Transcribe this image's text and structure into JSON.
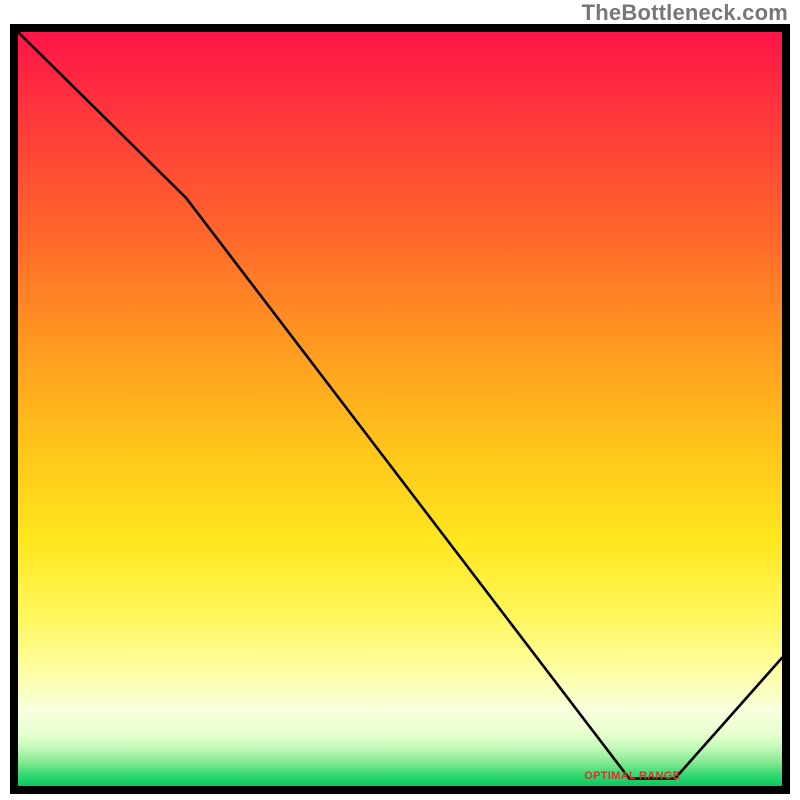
{
  "watermark": "TheBottleneck.com",
  "annotation": {
    "optimal_label": "OPTIMAL RANGE"
  },
  "chart_data": {
    "type": "line",
    "title": "",
    "xlabel": "",
    "ylabel": "",
    "xlim": [
      0,
      100
    ],
    "ylim": [
      0,
      100
    ],
    "grid": false,
    "legend": false,
    "x": [
      0,
      22,
      80,
      86,
      100
    ],
    "values": [
      100,
      78,
      1,
      1,
      17
    ],
    "optimal_range_x": [
      77,
      87
    ],
    "background": "vertical thermal gradient (red → yellow → green)"
  }
}
